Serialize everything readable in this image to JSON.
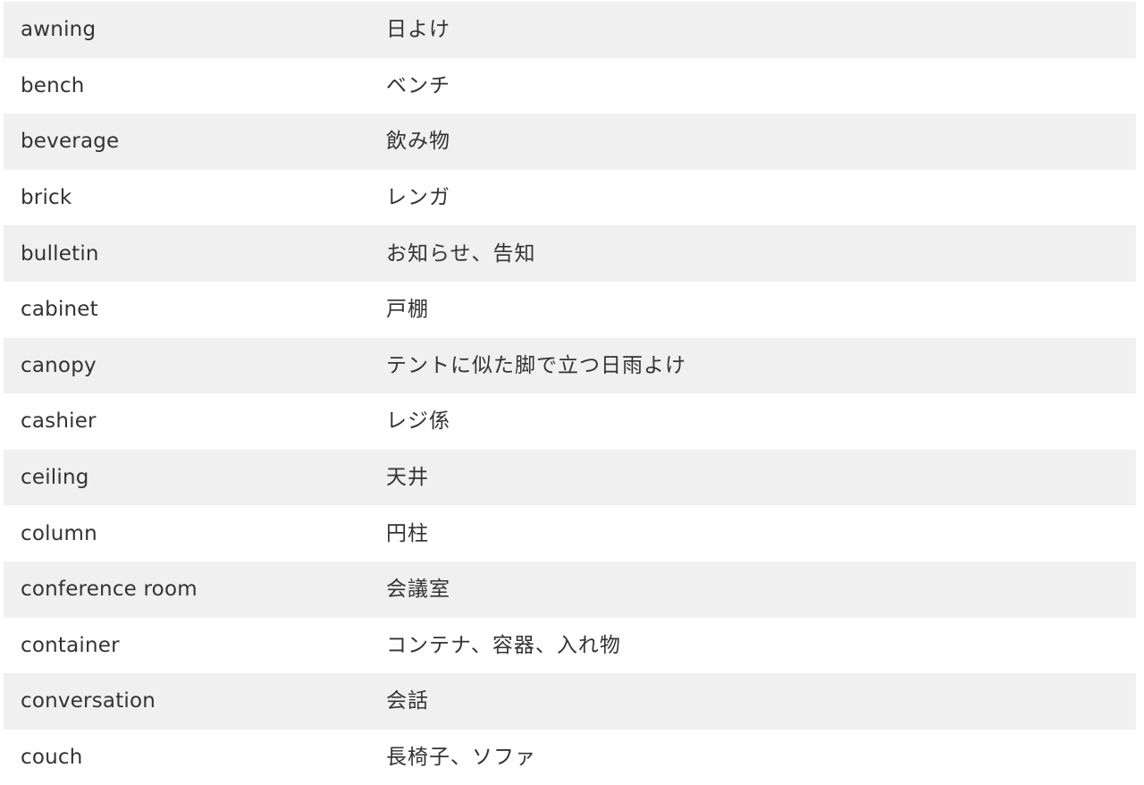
{
  "colors": {
    "row_shaded": "#f0f0f0",
    "row_plain": "#fefefe",
    "text": "#333333"
  },
  "rows": [
    {
      "en": "awning",
      "ja": "日よけ"
    },
    {
      "en": "bench",
      "ja": "ベンチ"
    },
    {
      "en": "beverage",
      "ja": "飲み物"
    },
    {
      "en": "brick",
      "ja": "レンガ"
    },
    {
      "en": "bulletin",
      "ja": "お知らせ、告知"
    },
    {
      "en": "cabinet",
      "ja": "戸棚"
    },
    {
      "en": "canopy",
      "ja": "テントに似た脚で立つ日雨よけ"
    },
    {
      "en": "cashier",
      "ja": "レジ係"
    },
    {
      "en": "ceiling",
      "ja": "天井"
    },
    {
      "en": "column",
      "ja": "円柱"
    },
    {
      "en": "conference room",
      "ja": "会議室"
    },
    {
      "en": "container",
      "ja": "コンテナ、容器、入れ物"
    },
    {
      "en": "conversation",
      "ja": "会話"
    },
    {
      "en": "couch",
      "ja": "長椅子、ソファ"
    }
  ]
}
